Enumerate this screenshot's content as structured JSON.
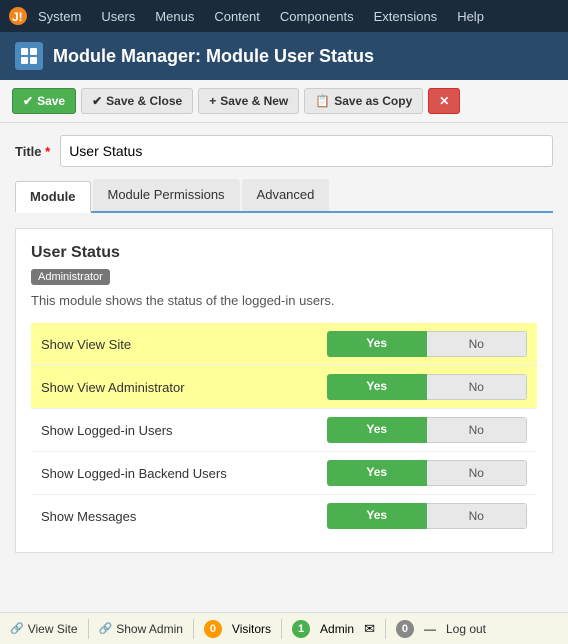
{
  "topnav": {
    "items": [
      {
        "label": "System"
      },
      {
        "label": "Users"
      },
      {
        "label": "Menus"
      },
      {
        "label": "Content"
      },
      {
        "label": "Components"
      },
      {
        "label": "Extensions"
      },
      {
        "label": "Help"
      }
    ]
  },
  "header": {
    "title": "Module Manager: Module User Status"
  },
  "toolbar": {
    "save_label": "Save",
    "save_close_label": "Save & Close",
    "save_new_label": "Save & New",
    "save_copy_label": "Save as Copy",
    "close_label": "✕"
  },
  "form": {
    "title_label": "Title",
    "title_required": "*",
    "title_value": "User Status"
  },
  "tabs": [
    {
      "label": "Module",
      "active": true
    },
    {
      "label": "Module Permissions",
      "active": false
    },
    {
      "label": "Advanced",
      "active": false
    }
  ],
  "module": {
    "title": "User Status",
    "badge": "Administrator",
    "description": "This module shows the status of the logged-in users.",
    "toggles": [
      {
        "label": "Show View Site",
        "yes": "Yes",
        "no": "No",
        "highlighted": true
      },
      {
        "label": "Show View Administrator",
        "yes": "Yes",
        "no": "No",
        "highlighted": true
      },
      {
        "label": "Show Logged-in Users",
        "yes": "Yes",
        "no": "No",
        "highlighted": false
      },
      {
        "label": "Show Logged-in Backend Users",
        "yes": "Yes",
        "no": "No",
        "highlighted": false
      },
      {
        "label": "Show Messages",
        "yes": "Yes",
        "no": "No",
        "highlighted": false
      }
    ]
  },
  "statusbar": {
    "view_site_label": "View Site",
    "show_admin_label": "Show Admin",
    "visitors_count": "0",
    "visitors_label": "Visitors",
    "admin_count": "1",
    "admin_label": "Admin",
    "messages_count": "0",
    "logout_label": "Log out"
  }
}
